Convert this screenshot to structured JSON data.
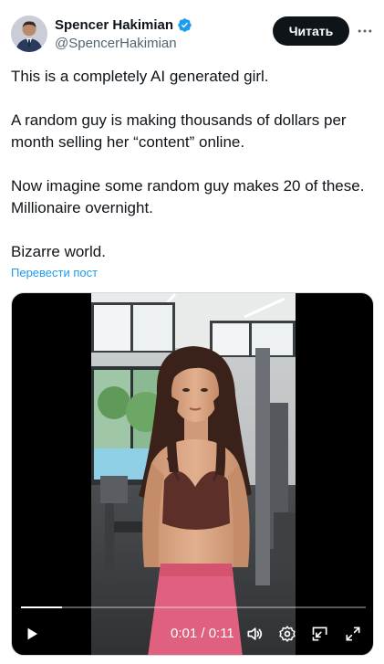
{
  "author": {
    "name": "Spencer Hakimian",
    "handle": "@SpencerHakimian",
    "verified": true
  },
  "actions": {
    "follow_label": "Читать"
  },
  "tweet": {
    "paragraphs": [
      "This is a completely AI generated girl.",
      "A random guy is making thousands of dollars per month selling her “content” online.",
      "Now imagine some random guy makes 20 of these. Millionaire overnight.",
      "Bizarre world."
    ],
    "translate_label": "Перевести пост"
  },
  "video": {
    "current_time": "0:01",
    "duration": "0:11",
    "time_display": "0:01 / 0:11",
    "progress": 0.12
  },
  "icons": {
    "verified": "verified-badge-icon",
    "more": "more-horizontal-icon",
    "play": "play-icon",
    "volume": "volume-icon",
    "settings": "gear-icon",
    "pip": "picture-in-picture-icon",
    "fullscreen": "fullscreen-icon"
  },
  "colors": {
    "accent": "#1d9bf0",
    "text": "#0f1419",
    "muted": "#536471",
    "follow_bg": "#0f1419"
  }
}
